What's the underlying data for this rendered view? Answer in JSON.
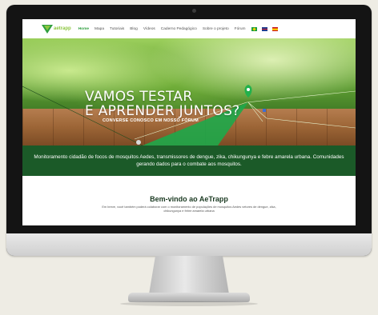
{
  "colors": {
    "brand_green": "#2e9e3e",
    "banner_green": "#1b5a28",
    "logo_green": "#8cc63f"
  },
  "nav": {
    "logo_text": "aetrapp",
    "items": [
      {
        "label": "Home",
        "active": true
      },
      {
        "label": "Mapa"
      },
      {
        "label": "Tutoriais"
      },
      {
        "label": "Blog"
      },
      {
        "label": "Vídeos"
      },
      {
        "label": "Caderno Pedagógico"
      },
      {
        "label": "Sobre o projeto"
      },
      {
        "label": "Fórum"
      }
    ],
    "flags": [
      "flag-br-icon",
      "flag-uk-icon",
      "flag-es-icon"
    ]
  },
  "hero": {
    "title_line1": "VAMOS TESTAR",
    "title_line2": "E APRENDER JUNTOS?",
    "subtitle": "CONVERSE CONOSCO EM NOSSO FÓRUM"
  },
  "banner": {
    "text": "Monitoramento cidadão de focos de mosquitos Aedes, transmissores de dengue, zika, chikungunya e febre amarela urbana. Comunidades gerando dados para o combate aos mosquitos."
  },
  "welcome": {
    "title": "Bem-vindo ao AeTrapp",
    "text": "Em breve, você também poderá colaborar com o monitoramento de populações de mosquitos Aedes vetores de dengue, zika, chikungunya e febre amarela urbana"
  }
}
